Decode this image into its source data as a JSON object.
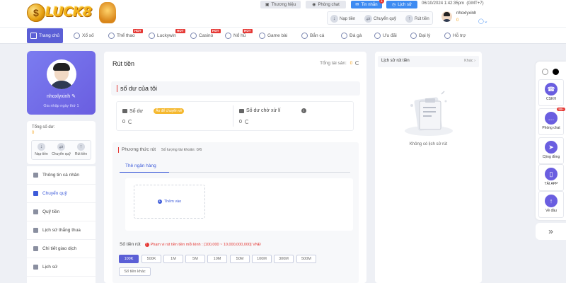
{
  "header": {
    "logo_text": "LUCK8",
    "top_buttons": [
      {
        "label": "Thương hiệu",
        "icon": "building-icon"
      },
      {
        "label": "Phòng chat",
        "icon": "chat-icon"
      },
      {
        "label": "Tin nhắn",
        "icon": "mail-icon",
        "badge": "1"
      },
      {
        "label": "Lịch sử",
        "icon": "history-icon"
      }
    ],
    "datetime": "06/10/2024 1:42:35pm",
    "timezone": "(GMT+7)",
    "account_actions": [
      {
        "label": "Nạp tiền",
        "icon": "deposit-icon"
      },
      {
        "label": "Chuyển quỹ",
        "icon": "transfer-icon"
      },
      {
        "label": "Rút tiền",
        "icon": "withdraw-icon"
      }
    ],
    "username": "nhoxlyxinh",
    "balance": "0"
  },
  "nav": {
    "items": [
      {
        "label": "Trang chủ",
        "active": true
      },
      {
        "label": "Xổ số"
      },
      {
        "label": "Thể thao",
        "badge": "HOT"
      },
      {
        "label": "Luckywin",
        "badge": "HOT"
      },
      {
        "label": "Casino",
        "badge": "HOT"
      },
      {
        "label": "Nổ hũ",
        "badge": "HOT"
      },
      {
        "label": "Game bài"
      },
      {
        "label": "Bắn cá"
      },
      {
        "label": "Đá gà"
      },
      {
        "label": "Ưu đãi"
      },
      {
        "label": "Đại lý"
      },
      {
        "label": "Hỗ trợ"
      }
    ]
  },
  "profile": {
    "name": "nhoxlyxinh",
    "login_text": "Gia nhập ngày thứ 1",
    "balance_label": "Tổng số dư:",
    "balance_value": "0",
    "actions": [
      "Nạp tiền",
      "Chuyển quỹ",
      "Rút tiền"
    ]
  },
  "side_menu": [
    {
      "label": "Thông tin cá nhân",
      "icon": "user-icon"
    },
    {
      "label": "Chuyển quỹ",
      "icon": "transfer-icon",
      "active": true
    },
    {
      "label": "Quỹ tiền",
      "icon": "fund-icon"
    },
    {
      "label": "Lịch sử thắng thua",
      "icon": "chart-icon"
    },
    {
      "label": "Chi tiết giao dịch",
      "icon": "list-icon"
    },
    {
      "label": "Lịch sử",
      "icon": "history-icon"
    }
  ],
  "main": {
    "title": "Rút tiền",
    "total_balance_label": "Tổng tài sản:",
    "total_balance_value": "0",
    "section_title": "số dư của tôi",
    "balance_label": "Số dư",
    "transfer_pill": "Ấn để chuyển về",
    "balance_value": "0",
    "pending_label": "Số dư chờ xử lí",
    "pending_value": "0",
    "method_title": "Phương thức rút",
    "bank_count_text": "Số lượng tài khoản:",
    "bank_count": "0/6",
    "tab_label": "Thẻ ngân hàng",
    "add_card_label": "Thêm vào",
    "amount_label": "Số tiền rút",
    "amount_warning": "Phạm vi rút tiền tiền mỗi lệnh : [100,000 ~ 10,000,000,000] VNĐ",
    "amount_chips": [
      "100K",
      "500K",
      "1M",
      "5M",
      "10M",
      "50M",
      "100M",
      "300M",
      "500M"
    ],
    "other_amount": "Số tiền khác"
  },
  "right_panel": {
    "title": "Lịch sử rút tiền",
    "filter": "Khác",
    "empty_text": "Không có lịch sử rút"
  },
  "float_bar": {
    "items": [
      {
        "label": "CSKH",
        "icon": "support-icon"
      },
      {
        "label": "Phòng chat",
        "icon": "chat-icon",
        "badge": "99+"
      },
      {
        "label": "Cộng đồng",
        "icon": "telegram-icon"
      },
      {
        "label": "TẢI APP",
        "icon": "download-icon"
      },
      {
        "label": "Về đầu",
        "icon": "arrow-up-icon"
      }
    ]
  },
  "colors": {
    "primary": "#5b5fd6",
    "accent_yellow": "#f5b82e",
    "alert_red": "#e53935",
    "link_blue": "#3d5bd9"
  }
}
